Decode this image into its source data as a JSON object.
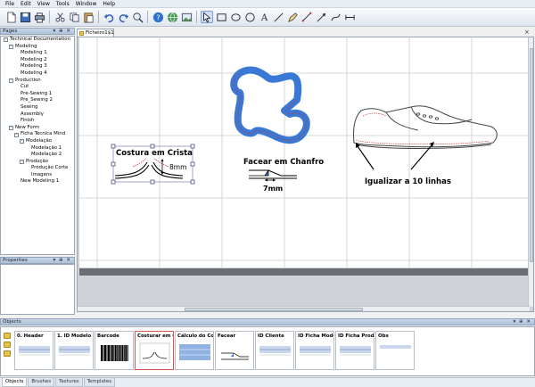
{
  "menu": [
    "File",
    "Edit",
    "View",
    "Tools",
    "Window",
    "Help"
  ],
  "toolbar_icons": [
    "new-icon",
    "save-icon",
    "print-icon",
    "cut-icon",
    "copy-icon",
    "paste-icon",
    "undo-icon",
    "redo-icon",
    "zoom-icon",
    "help-icon",
    "web-icon",
    "image-icon",
    "select-icon",
    "rectangle-icon",
    "ellipse-icon",
    "circle-icon",
    "text-icon",
    "line-icon",
    "pen-icon",
    "measure-icon",
    "arrow-icon",
    "path-icon",
    "dimension-icon"
  ],
  "pages_panel": {
    "title": "Pages",
    "tree": [
      {
        "label": "Technical Documentation",
        "level": 0,
        "toggle": "-"
      },
      {
        "label": "Modeling",
        "level": 1,
        "toggle": "-"
      },
      {
        "label": "Modeling 1",
        "level": 2
      },
      {
        "label": "Modeling 2",
        "level": 2
      },
      {
        "label": "Modeling 3",
        "level": 2
      },
      {
        "label": "Modeling 4",
        "level": 2
      },
      {
        "label": "Production",
        "level": 1,
        "toggle": "-"
      },
      {
        "label": "Cut",
        "level": 2
      },
      {
        "label": "Pre-Sewing 1",
        "level": 2
      },
      {
        "label": "Pre_Sewing 2",
        "level": 2
      },
      {
        "label": "Sewing",
        "level": 2
      },
      {
        "label": "Assembly",
        "level": 2
      },
      {
        "label": "Finish",
        "level": 2
      },
      {
        "label": "New Form",
        "level": 1,
        "toggle": "-"
      },
      {
        "label": "Ficha Técnica Mind",
        "level": 2,
        "toggle": "-"
      },
      {
        "label": "Modelação",
        "level": 3,
        "toggle": "-"
      },
      {
        "label": "Modelação 1",
        "level": 4
      },
      {
        "label": "Modelação 2",
        "level": 4
      },
      {
        "label": "Produção",
        "level": 3,
        "toggle": "-"
      },
      {
        "label": "Produção Corte",
        "level": 4
      },
      {
        "label": "Imagens",
        "level": 4
      },
      {
        "label": "New Modeling 1",
        "level": 2
      }
    ]
  },
  "properties_panel": {
    "title": "Properties"
  },
  "document_tab": {
    "label": "Ficheiro1$1"
  },
  "canvas": {
    "costura_label": "Costura em Crista",
    "costura_measure": "8mm",
    "facear_label": "Facear em Chanfro",
    "facear_measure": "7mm",
    "igualizar_label": "Igualizar a 10 linhas"
  },
  "objects_panel": {
    "title": "Objects",
    "items": [
      {
        "label": "0. Header"
      },
      {
        "label": "1. ID Modelo"
      },
      {
        "label": "Barcode"
      },
      {
        "label": "Costurar em C",
        "selected": true,
        "thumb_text": "Costura em Crista"
      },
      {
        "label": "Cálculo do Cor"
      },
      {
        "label": "Facear"
      },
      {
        "label": "ID Cliente"
      },
      {
        "label": "ID Ficha Mode"
      },
      {
        "label": "ID Ficha Prod"
      },
      {
        "label": "Obs"
      }
    ]
  },
  "bottom_tabs": [
    "Objects",
    "Brushes",
    "Textures",
    "Templates"
  ],
  "colors": {
    "accent": "#3a78d6",
    "selection": "#d9534f",
    "dashed_line": "#c43a3a"
  }
}
